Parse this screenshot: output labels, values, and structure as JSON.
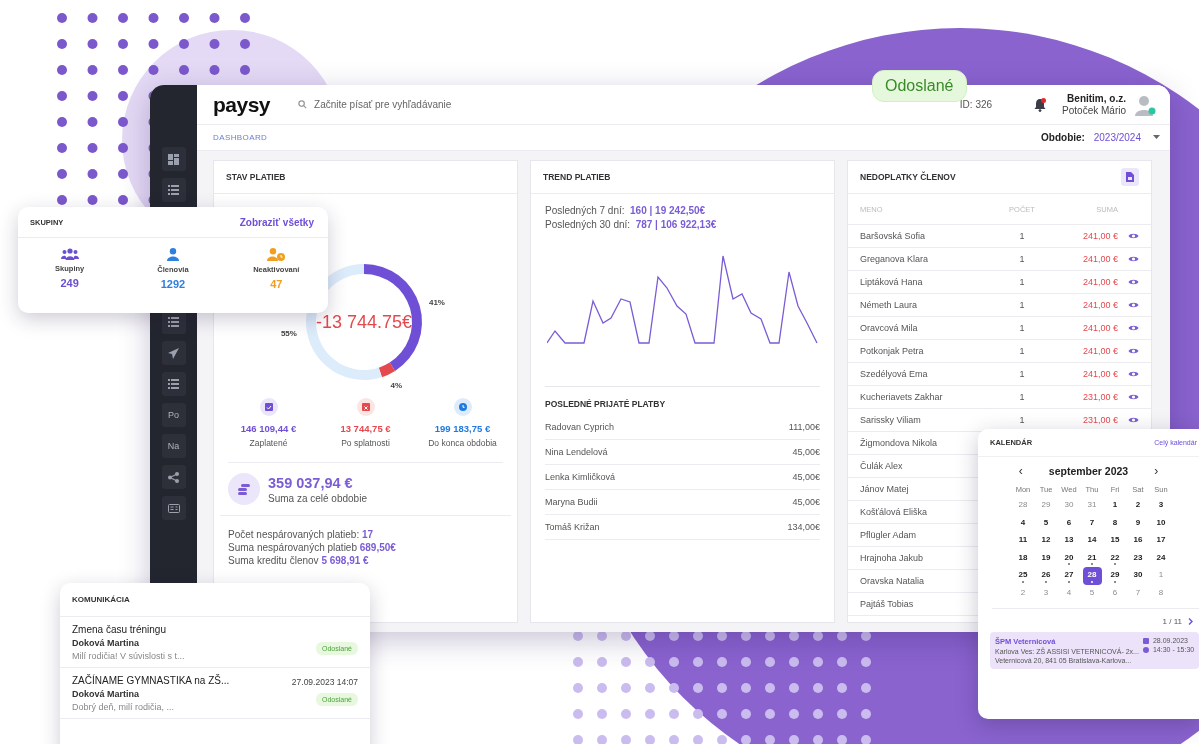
{
  "status_badge": {
    "label": "Odoslané"
  },
  "sidebar": {
    "items": [
      {
        "kind": "grid"
      },
      {
        "kind": "list"
      },
      {
        "kind": "list"
      },
      {
        "kind": "send"
      },
      {
        "kind": "list"
      },
      {
        "kind": "text",
        "label": "Po"
      },
      {
        "kind": "text",
        "label": "Na"
      },
      {
        "kind": "share"
      },
      {
        "kind": "card"
      }
    ]
  },
  "header": {
    "logo": "paysy",
    "search": {
      "placeholder": "Začnite písať pre vyhľadávanie"
    },
    "id": "ID: 326",
    "notifications": {
      "unread": true
    },
    "user": {
      "org": "Benitim, o.z.",
      "name": "Potoček Mário",
      "online": true
    }
  },
  "breadcrumb": "DASHBOARD",
  "period": {
    "label": "Obdobie:",
    "value": "2023/2024"
  },
  "payment_status": {
    "title": "STAV PLATIEB",
    "chart_data": {
      "type": "donut",
      "values": [
        41,
        4,
        55
      ],
      "value_labels": [
        "41%",
        "4%",
        "55%"
      ]
    },
    "center": "-13 744.75€",
    "stats": [
      {
        "kind": "paid",
        "value": "146 109,44 €",
        "label": "Zaplatené",
        "color": "#6f4fd6"
      },
      {
        "kind": "overdue",
        "value": "13 744,75 €",
        "label": "Po splatnosti",
        "color": "#e5484d"
      },
      {
        "kind": "remaining",
        "value": "199 183,75 €",
        "label": "Do konca obdobia",
        "color": "#1f7ae0"
      }
    ],
    "total": {
      "value": "359 037,94 €",
      "label": "Suma za celé obdobie"
    },
    "lines": [
      {
        "label": "Počet nespárovaných platieb:",
        "value": "17"
      },
      {
        "label": "Suma nespárovaných platieb",
        "value": "689,50€"
      },
      {
        "label": "Suma kreditu členov",
        "value": "5 698,91 €"
      }
    ]
  },
  "trend": {
    "title": "TREND PLATIEB",
    "lines": [
      {
        "label": "Posledných 7 dní:",
        "value": "160 | 19 242,50€"
      },
      {
        "label": "Posledných 30 dní:",
        "value": "787 | 106 922,13€"
      }
    ],
    "recent": {
      "title": "POSLEDNÉ PRIJATÉ PLATBY",
      "rows": [
        {
          "name": "Radovan Cyprich",
          "amount": "111,00€"
        },
        {
          "name": "Nina Lendelová",
          "amount": "45,00€"
        },
        {
          "name": "Lenka Kimličková",
          "amount": "45,00€"
        },
        {
          "name": "Maryna Budii",
          "amount": "45,00€"
        },
        {
          "name": "Tomáš Križan",
          "amount": "134,00€"
        }
      ]
    }
  },
  "arrears": {
    "title": "NEDOPLATKY ČLENOV",
    "columns": [
      "MENO",
      "POČET",
      "SUMA"
    ],
    "rows": [
      {
        "name": "Baršovská Sofia",
        "count": "1",
        "sum": "241,00 €"
      },
      {
        "name": "Greganova Klara",
        "count": "1",
        "sum": "241,00 €"
      },
      {
        "name": "Liptáková Hana",
        "count": "1",
        "sum": "241,00 €"
      },
      {
        "name": "Németh Laura",
        "count": "1",
        "sum": "241,00 €"
      },
      {
        "name": "Oravcová Mila",
        "count": "1",
        "sum": "241,00 €"
      },
      {
        "name": "Potkonjak Petra",
        "count": "1",
        "sum": "241,00 €"
      },
      {
        "name": "Szedélyová Ema",
        "count": "1",
        "sum": "241,00 €"
      },
      {
        "name": "Kucheriavets Zakhar",
        "count": "1",
        "sum": "231,00 €"
      },
      {
        "name": "Sarissky Viliam",
        "count": "1",
        "sum": "231,00 €"
      },
      {
        "name": "Žigmondova Nikola"
      },
      {
        "name": "Čulák Alex"
      },
      {
        "name": "Jánov Matej"
      },
      {
        "name": "Košťálová Eliška"
      },
      {
        "name": "Pflügler Adam"
      },
      {
        "name": "Hrajnoha Jakub"
      },
      {
        "name": "Oravska Natalia"
      },
      {
        "name": "Pajtáš Tobias"
      }
    ]
  },
  "groups": {
    "title": "SKUPINY",
    "link": "Zobraziť všetky",
    "stats": [
      {
        "kind": "groups",
        "label": "Skupiny",
        "value": "249",
        "color": "#6c4fd1"
      },
      {
        "kind": "members",
        "label": "Členovia",
        "value": "1292",
        "color": "#2f7fe0"
      },
      {
        "kind": "inactive",
        "label": "Neaktivovaní",
        "value": "47",
        "color": "#f0a020"
      }
    ]
  },
  "communication": {
    "title": "KOMUNIKÁCIA",
    "items": [
      {
        "title": "Zmena času tréningu",
        "author": "Doková Martina",
        "preview": "Milí rodičia! V súvislosti s t...",
        "status": "Odoslané"
      },
      {
        "title": "ZAČÍNAME GYMNASTIKA na ZŠ...",
        "date": "27.09.2023 14:07",
        "author": "Doková Martina",
        "preview": "Dobrý deň, milí rodičia,  ...",
        "status": "Odoslané"
      }
    ]
  },
  "calendar": {
    "title": "KALENDÁR",
    "link": "Celý kalendár",
    "prev": "‹",
    "month": "september 2023",
    "next": "›",
    "weekdays": [
      "Mon",
      "Tue",
      "Wed",
      "Thu",
      "Fri",
      "Sat",
      "Sun"
    ],
    "weeks": [
      [
        {
          "day": "28",
          "muted": true,
          "dot": false,
          "selected": false
        },
        {
          "day": "29",
          "muted": true,
          "dot": false,
          "selected": false
        },
        {
          "day": "30",
          "muted": true,
          "dot": false,
          "selected": false
        },
        {
          "day": "31",
          "muted": true,
          "dot": false,
          "selected": false
        },
        {
          "day": "1",
          "muted": false,
          "dot": false,
          "selected": false
        },
        {
          "day": "2",
          "muted": false,
          "dot": false,
          "selected": false
        },
        {
          "day": "3",
          "muted": false,
          "dot": false,
          "selected": false
        }
      ],
      [
        {
          "day": "4",
          "muted": false,
          "dot": false,
          "selected": false
        },
        {
          "day": "5",
          "muted": false,
          "dot": false,
          "selected": false
        },
        {
          "day": "6",
          "muted": false,
          "dot": false,
          "selected": false
        },
        {
          "day": "7",
          "muted": false,
          "dot": false,
          "selected": false
        },
        {
          "day": "8",
          "muted": false,
          "dot": false,
          "selected": false
        },
        {
          "day": "9",
          "muted": false,
          "dot": false,
          "selected": false
        },
        {
          "day": "10",
          "muted": false,
          "dot": false,
          "selected": false
        }
      ],
      [
        {
          "day": "11",
          "muted": false,
          "dot": false,
          "selected": false
        },
        {
          "day": "12",
          "muted": false,
          "dot": false,
          "selected": false
        },
        {
          "day": "13",
          "muted": false,
          "dot": false,
          "selected": false
        },
        {
          "day": "14",
          "muted": false,
          "dot": false,
          "selected": false
        },
        {
          "day": "15",
          "muted": false,
          "dot": false,
          "selected": false
        },
        {
          "day": "16",
          "muted": false,
          "dot": false,
          "selected": false
        },
        {
          "day": "17",
          "muted": false,
          "dot": false,
          "selected": false
        }
      ],
      [
        {
          "day": "18",
          "muted": false,
          "dot": false,
          "selected": false
        },
        {
          "day": "19",
          "muted": false,
          "dot": false,
          "selected": false
        },
        {
          "day": "20",
          "muted": false,
          "dot": true,
          "selected": false
        },
        {
          "day": "21",
          "muted": false,
          "dot": true,
          "selected": false
        },
        {
          "day": "22",
          "muted": false,
          "dot": true,
          "selected": false
        },
        {
          "day": "23",
          "muted": false,
          "dot": false,
          "selected": false
        },
        {
          "day": "24",
          "muted": false,
          "dot": false,
          "selected": false
        }
      ],
      [
        {
          "day": "25",
          "muted": false,
          "dot": true,
          "selected": false
        },
        {
          "day": "26",
          "muted": false,
          "dot": true,
          "selected": false
        },
        {
          "day": "27",
          "muted": false,
          "dot": true,
          "selected": false
        },
        {
          "day": "28",
          "muted": false,
          "dot": true,
          "selected": true
        },
        {
          "day": "29",
          "muted": false,
          "dot": true,
          "selected": false
        },
        {
          "day": "30",
          "muted": false,
          "dot": false,
          "selected": false
        },
        {
          "day": "1",
          "muted": true,
          "dot": false,
          "selected": false
        }
      ],
      [
        {
          "day": "2",
          "muted": true,
          "dot": false,
          "selected": false
        },
        {
          "day": "3",
          "muted": true,
          "dot": false,
          "selected": false
        },
        {
          "day": "4",
          "muted": true,
          "dot": false,
          "selected": false
        },
        {
          "day": "5",
          "muted": true,
          "dot": false,
          "selected": false
        },
        {
          "day": "6",
          "muted": true,
          "dot": false,
          "selected": false
        },
        {
          "day": "7",
          "muted": true,
          "dot": false,
          "selected": false
        },
        {
          "day": "8",
          "muted": true,
          "dot": false,
          "selected": false
        }
      ]
    ],
    "pager": "1 / 11",
    "event": {
      "title": "ŠPM Veternicová",
      "place": "Karlova Ves: ZŠ ASSISI VETERNICOVÁ- 2x...",
      "address": "Veternicová 20, 841 05 Bratislava-Karlova...",
      "date": "28.09.2023",
      "time": "14:30 - 15:30"
    }
  }
}
